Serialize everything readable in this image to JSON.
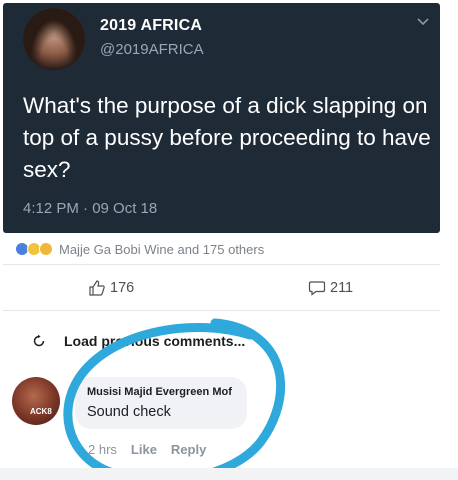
{
  "tweet": {
    "name": "2019 AFRICA",
    "handle": "@2019AFRICA",
    "text": "What's the purpose of a dick slapping on top of a pussy before proceeding to have sex?",
    "timestamp": "4:12 PM · 09 Oct 18"
  },
  "reactions": {
    "text": "Majje Ga Bobi Wine and 175 others",
    "icons": [
      "like-icon",
      "haha-icon",
      "wow-icon"
    ]
  },
  "stats": {
    "likes": "176",
    "comments": "211"
  },
  "load_comments": {
    "label": "Load previous comments..."
  },
  "comment": {
    "author": "Musisi Majid Evergreen Mof",
    "text": "Sound check",
    "avatar_text": "ACK8",
    "time": "2 hrs",
    "like_label": "Like",
    "reply_label": "Reply"
  },
  "colors": {
    "tweet_bg": "#1f2a37",
    "circle_annotation": "#2fa8dc"
  }
}
